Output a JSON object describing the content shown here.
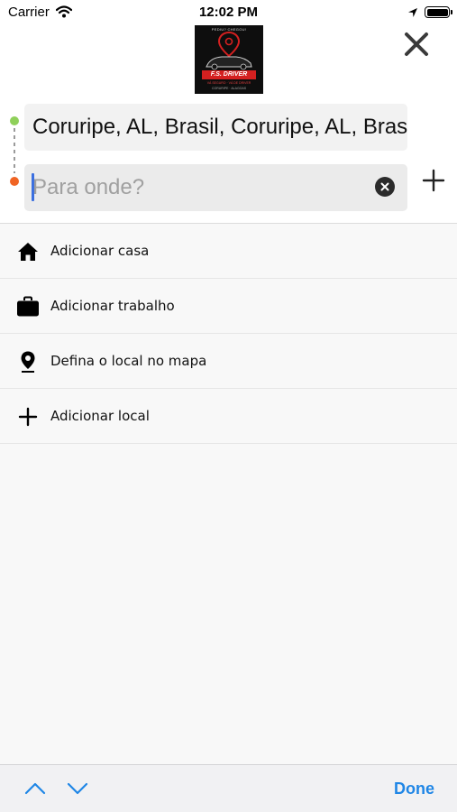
{
  "status_bar": {
    "carrier": "Carrier",
    "time": "12:02 PM",
    "icons": [
      "wifi-icon",
      "location-arrow-icon",
      "battery-icon"
    ]
  },
  "header": {
    "logo": {
      "top_text": "PEDIU? CHEGOU!",
      "name": "F.S. DRIVER",
      "tagline": "VÁ SEGURO · VÁ DE DRIVER",
      "sub_text": "CORURIPE · ALAGOAS"
    },
    "close_icon": "close-icon"
  },
  "route": {
    "origin_value": "Coruripe, AL, Brasil, Coruripe, AL, Brasil",
    "destination_value": "",
    "destination_placeholder": "Para onde?",
    "origin_dot_color": "#8fd05a",
    "destination_dot_color": "#f06424",
    "clear_icon": "clear-icon",
    "add_stop_icon": "plus-icon"
  },
  "shortcuts": [
    {
      "label": "Adicionar casa",
      "icon": "home-icon"
    },
    {
      "label": "Adicionar trabalho",
      "icon": "briefcase-icon"
    },
    {
      "label": "Defina o local no mapa",
      "icon": "map-pin-icon"
    },
    {
      "label": "Adicionar local",
      "icon": "plus-icon"
    }
  ],
  "keyboard_toolbar": {
    "prev_icon": "chevron-up-icon",
    "next_icon": "chevron-down-icon",
    "done_label": "Done",
    "accent_color": "#1f86e6"
  }
}
